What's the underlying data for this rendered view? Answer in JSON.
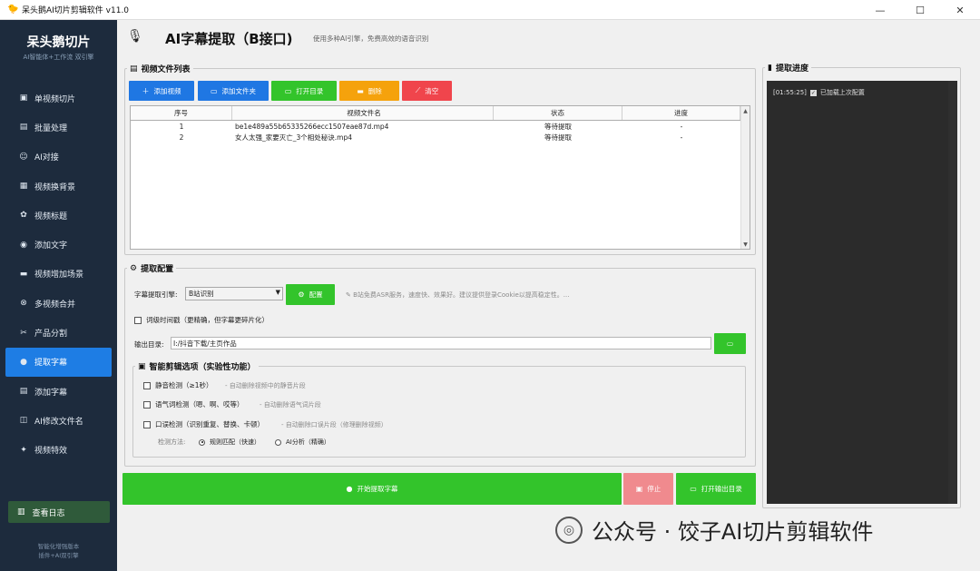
{
  "window": {
    "title": "呆头鹅AI切片剪辑软件 v11.0",
    "controls": [
      "—",
      "☐",
      "✕"
    ]
  },
  "sidebar": {
    "brand": "呆头鹅切片",
    "brand_sub": "AI智能体+工作流 双引擎",
    "items": [
      {
        "label": "单视频切片",
        "icon": "film-icon"
      },
      {
        "label": "批量处理",
        "icon": "batch-icon"
      },
      {
        "label": "AI对接",
        "icon": "robot-icon"
      },
      {
        "label": "视频换背景",
        "icon": "image-icon"
      },
      {
        "label": "视频标题",
        "icon": "palette-icon"
      },
      {
        "label": "添加文字",
        "icon": "eye-icon"
      },
      {
        "label": "视频增加场景",
        "icon": "scene-icon"
      },
      {
        "label": "多视频合并",
        "icon": "link-icon"
      },
      {
        "label": "产品分割",
        "icon": "scissors-icon"
      },
      {
        "label": "提取字幕",
        "icon": "mic-icon",
        "active": true
      },
      {
        "label": "添加字幕",
        "icon": "doc-icon"
      },
      {
        "label": "AI修改文件名",
        "icon": "rename-icon"
      },
      {
        "label": "视频特效",
        "icon": "sparkle-icon"
      }
    ],
    "log_button": "查看日志",
    "footer1": "智能化增强版本",
    "footer2": "插件+AI双引擎"
  },
  "header": {
    "title": "AI字幕提取（B接口)",
    "subtitle": "使用多种AI引擎，免费高效的语音识别"
  },
  "file_list": {
    "title": "视频文件列表",
    "buttons": {
      "add_video": "添加视频",
      "add_folder": "添加文件夹",
      "open_dir": "打开目录",
      "delete": "删除",
      "clear": "清空"
    },
    "columns": [
      "序号",
      "视频文件名",
      "状态",
      "进度"
    ],
    "rows": [
      {
        "index": "1",
        "name": "be1e489a55b65335266ecc1507eae87d.mp4",
        "status": "等待提取",
        "progress": "-"
      },
      {
        "index": "2",
        "name": "女人太强_家要灭亡_3个相处秘诀.mp4",
        "status": "等待提取",
        "progress": "-"
      }
    ]
  },
  "config": {
    "title": "提取配置",
    "engine_label": "字幕提取引擎:",
    "engine_value": "B站识别",
    "config_button": "配置",
    "engine_hint": "B站免费ASR服务，速度快、效果好。建议提供登录Cookie以提高稳定性。...",
    "word_timestamp": "词级时间戳（更精确，但字幕更碎片化）",
    "output_label": "输出目录:",
    "output_value": "I:/抖音下载/主页作品",
    "smart_title": "智能剪辑选项（实验性功能）",
    "options": [
      {
        "label": "静音检测（≥1秒）",
        "hint": "- 自动删除视频中的静音片段"
      },
      {
        "label": "语气词检测（嗯、啊、哎等）",
        "hint": "- 自动删除语气词片段"
      },
      {
        "label": "口误检测（识别重复、替换、卡顿）",
        "hint": "- 自动删除口误片段（修理删除视频）"
      }
    ],
    "method_label": "检测方法:",
    "method_rule": "规则匹配（快速）",
    "method_ai": "AI分析（精确）"
  },
  "actions": {
    "start": "开始提取字幕",
    "stop": "停止",
    "open_output": "打开输出目录"
  },
  "progress_panel": {
    "title": "提取进度",
    "log_time": "[01:55:25]",
    "log_text": "已加载上次配置"
  },
  "watermark": "公众号 · 饺子AI切片剪辑软件"
}
